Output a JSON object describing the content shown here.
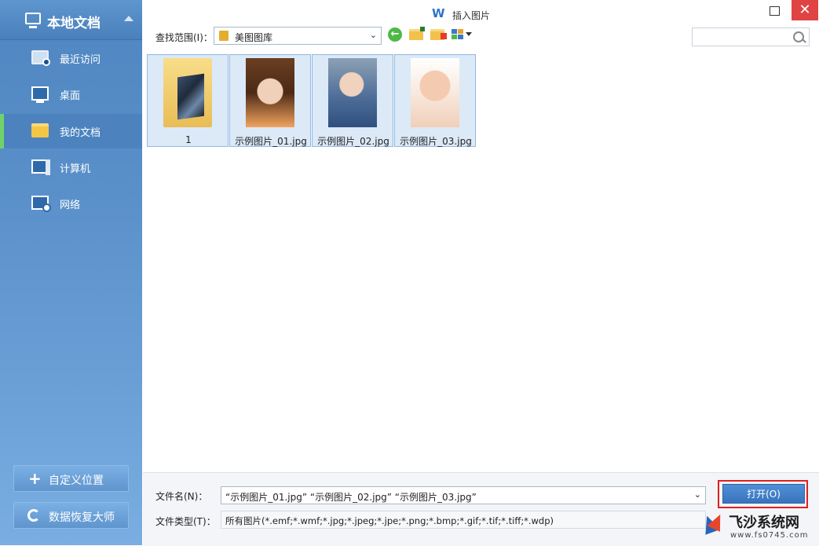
{
  "sidebar": {
    "title": "本地文档",
    "items": [
      {
        "label": "最近访问",
        "icon": "recent-folder-icon"
      },
      {
        "label": "桌面",
        "icon": "desktop-icon"
      },
      {
        "label": "我的文档",
        "icon": "folder-icon"
      },
      {
        "label": "计算机",
        "icon": "computer-icon"
      },
      {
        "label": "网络",
        "icon": "network-icon"
      }
    ],
    "active_index": 2,
    "buttons": {
      "custom_location": "自定义位置",
      "data_recovery": "数据恢复大师"
    }
  },
  "window": {
    "logo": "W",
    "title": "插入图片",
    "close": "✕"
  },
  "toolbar": {
    "lookin_label": "查找范围(I)：",
    "lookin_value": "美图图库",
    "back_glyph": "←",
    "search_placeholder": ""
  },
  "files": [
    {
      "name": "1",
      "type": "folder"
    },
    {
      "name": "示例图片_01.jpg",
      "type": "image"
    },
    {
      "name": "示例图片_02.jpg",
      "type": "image"
    },
    {
      "name": "示例图片_03.jpg",
      "type": "image"
    }
  ],
  "bottom": {
    "filename_label": "文件名(N)：",
    "filename_value": "“示例图片_01.jpg” “示例图片_02.jpg” “示例图片_03.jpg”",
    "filetype_label": "文件类型(T)：",
    "filetype_value": "所有图片(*.emf;*.wmf;*.jpg;*.jpeg;*.jpe;*.png;*.bmp;*.gif;*.tif;*.tiff;*.wdp)",
    "open_label": "打开(O)"
  },
  "watermark": {
    "name": "飞沙系统网",
    "url": "www.fs0745.com"
  },
  "colors": {
    "sidebar": "#5a90c9",
    "active_bar": "#6fd36a",
    "close": "#e04343",
    "open_button": "#3f7fc9",
    "highlight": "#e02020"
  }
}
